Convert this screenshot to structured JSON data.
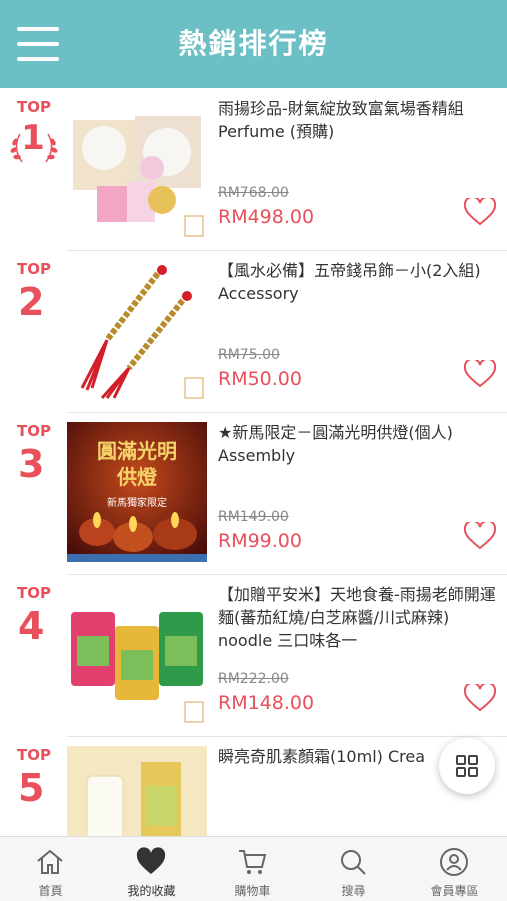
{
  "header": {
    "title": "熱銷排行榜",
    "menu_icon": "hamburger-menu-icon"
  },
  "products": [
    {
      "top_label": "TOP",
      "rank": "1",
      "name": "雨揚珍品-財氣綻放致富氣場香精組 Perfume (預購)",
      "old_price": "RM768.00",
      "new_price": "RM498.00"
    },
    {
      "top_label": "TOP",
      "rank": "2",
      "name": "【風水必備】五帝錢吊飾－小(2入組) Accessory",
      "old_price": "RM75.00",
      "new_price": "RM50.00"
    },
    {
      "top_label": "TOP",
      "rank": "3",
      "name": "★新馬限定－圓滿光明供燈(個人) Assembly",
      "old_price": "RM149.00",
      "new_price": "RM99.00",
      "image_text": {
        "line1": "圓滿光明",
        "line2": "供燈",
        "line3": "新馬獨家限定"
      }
    },
    {
      "top_label": "TOP",
      "rank": "4",
      "name": "【加贈平安米】天地食養-雨揚老師開運麵(蕃茄紅燒/白芝麻醬/川式麻辣) noodle 三口味各一",
      "old_price": "RM222.00",
      "new_price": "RM148.00"
    },
    {
      "top_label": "TOP",
      "rank": "5",
      "name": "瞬亮奇肌素顏霜(10ml) Crea",
      "old_price": "",
      "new_price": ""
    }
  ],
  "tabbar": {
    "items": [
      {
        "label": "首頁",
        "icon": "home-icon"
      },
      {
        "label": "我的收藏",
        "icon": "heart-filled-icon"
      },
      {
        "label": "購物車",
        "icon": "cart-icon"
      },
      {
        "label": "搜尋",
        "icon": "search-icon"
      },
      {
        "label": "會員專區",
        "icon": "user-icon"
      }
    ],
    "active": "我的收藏"
  },
  "fab_icon": "grid-icon",
  "colors": {
    "header": "#6bbfc5",
    "accent": "#e8505b"
  }
}
